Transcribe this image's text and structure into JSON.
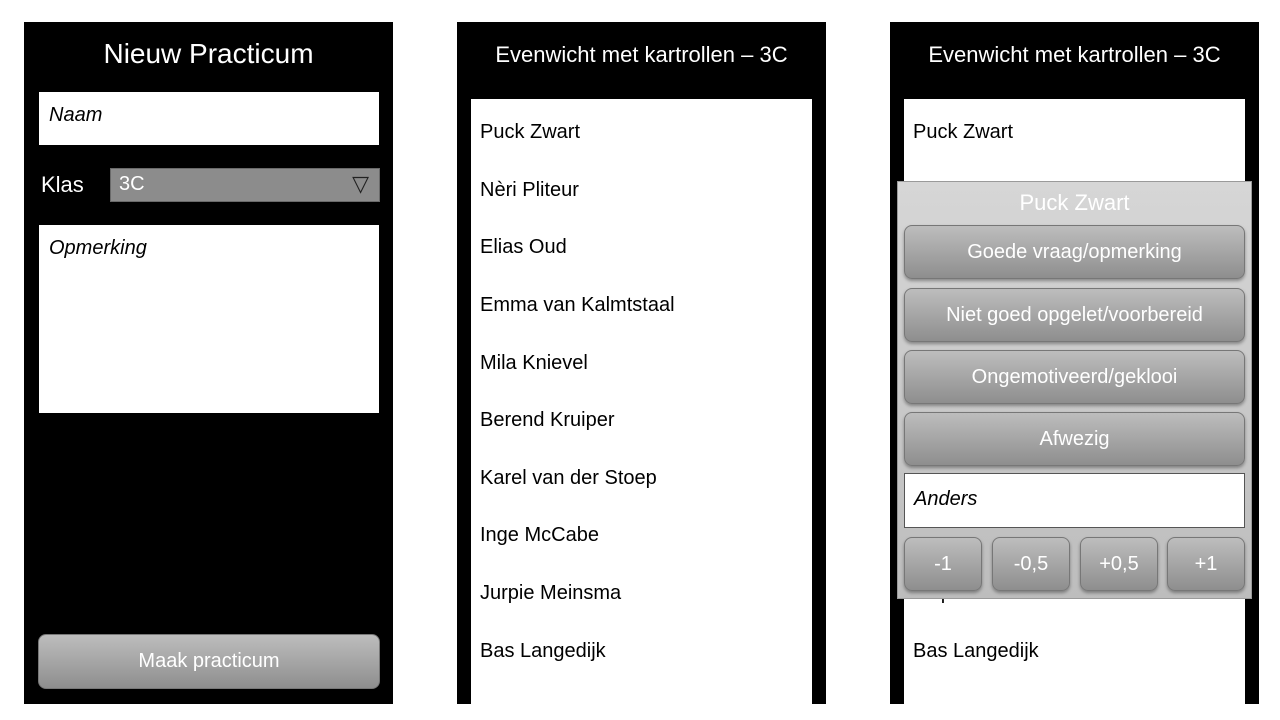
{
  "screen1": {
    "title": "Nieuw Practicum",
    "naam_placeholder": "Naam",
    "klas_label": "Klas",
    "klas_value": "3C",
    "opmerking_placeholder": "Opmerking",
    "submit_label": "Maak practicum"
  },
  "screen2": {
    "title": "Evenwicht met kartrollen – 3C",
    "students": [
      "Puck Zwart",
      "Nèri Pliteur",
      "Elias Oud",
      "Emma van Kalmtstaal",
      "Mila Knievel",
      "Berend Kruiper",
      "Karel van der Stoep",
      "Inge McCabe",
      "Jurpie Meinsma",
      "Bas Langedijk"
    ]
  },
  "screen3": {
    "title": "Evenwicht met kartrollen – 3C",
    "visible_students": [
      "Puck Zwart",
      "Jurpie Meinsma",
      "Bas Langedijk"
    ],
    "popup": {
      "title": "Puck Zwart",
      "options": [
        "Goede vraag/opmerking",
        "Niet goed opgelet/voorbereid",
        "Ongemotiveerd/geklooi",
        "Afwezig"
      ],
      "other_placeholder": "Anders",
      "scores": [
        "-1",
        "-0,5",
        "+0,5",
        "+1"
      ]
    }
  }
}
